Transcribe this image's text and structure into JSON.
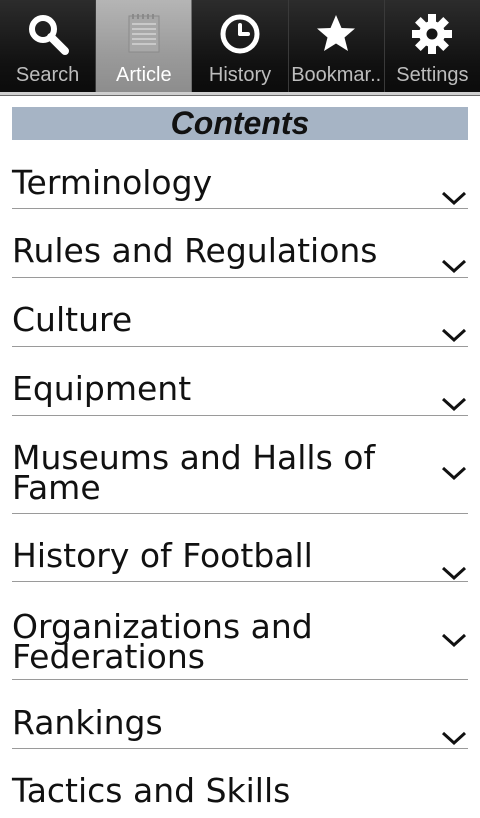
{
  "tabs": [
    {
      "label": "Search",
      "icon": "search-icon",
      "active": false
    },
    {
      "label": "Article",
      "icon": "notepad-icon",
      "active": true
    },
    {
      "label": "History",
      "icon": "clock-icon",
      "active": false
    },
    {
      "label": "Bookmar..",
      "icon": "star-icon",
      "active": false
    },
    {
      "label": "Settings",
      "icon": "gear-icon",
      "active": false
    }
  ],
  "contents": {
    "title": "Contents",
    "items": [
      {
        "label": "Terminology"
      },
      {
        "label": "Rules and Regulations"
      },
      {
        "label": "Culture"
      },
      {
        "label": "Equipment"
      },
      {
        "label": "Museums and Halls of Fame"
      },
      {
        "label": "History of Football"
      },
      {
        "label": "Organizations and Federations"
      },
      {
        "label": "Rankings"
      },
      {
        "label": "Tactics and Skills"
      }
    ]
  },
  "colors": {
    "header_bg": "#a6b4c5",
    "active_tab": "#9a9a9a",
    "tabbar_bg": "#111111"
  }
}
